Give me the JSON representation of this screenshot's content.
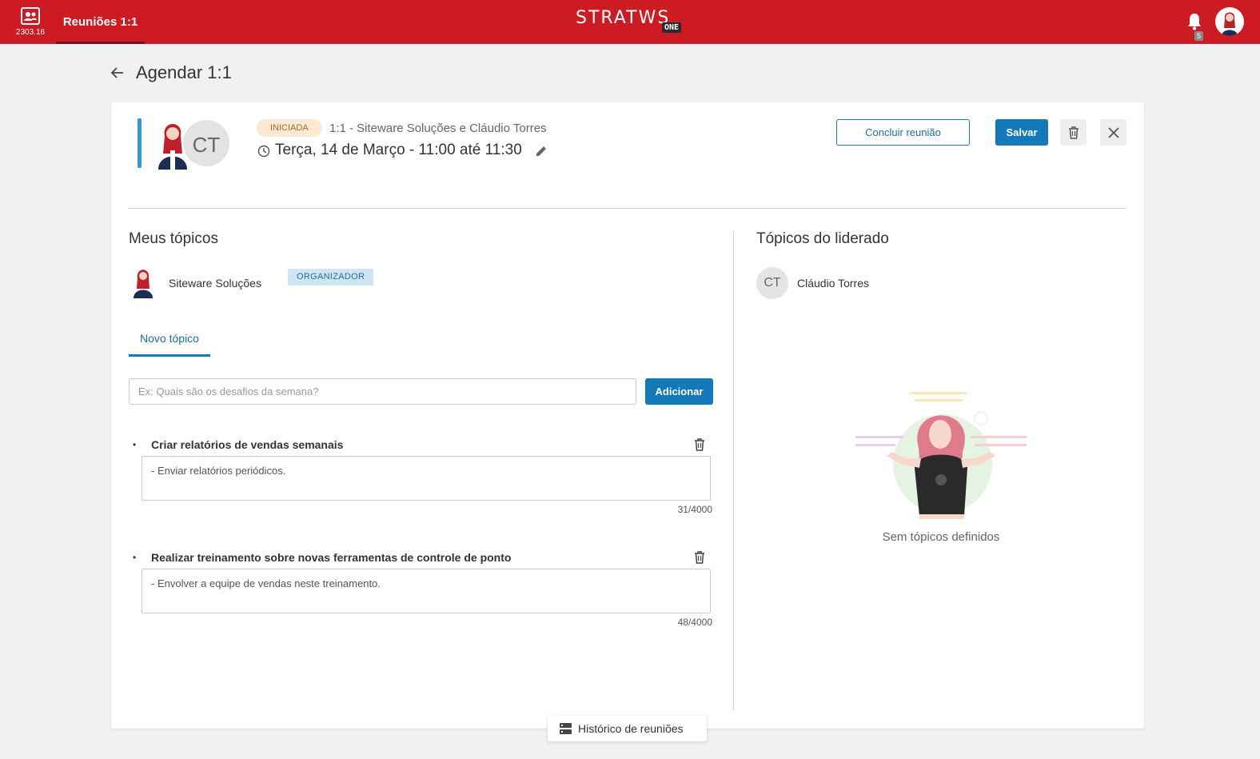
{
  "topbar": {
    "app_code": "2303.16",
    "nav_tab": "Reuniões 1:1",
    "logo_text": "STRATWS",
    "logo_badge": "ONE",
    "notification_count": "5"
  },
  "page": {
    "title": "Agendar 1:1"
  },
  "meeting": {
    "status": "INICIADA",
    "title": "1:1 - Siteware Soluções e Cláudio Torres",
    "datetime": "Terça, 14 de Março - 11:00 até 11:30",
    "leader_initials": "CT",
    "actions": {
      "conclude": "Concluir reunião",
      "save": "Salvar"
    }
  },
  "my_topics": {
    "heading": "Meus tópicos",
    "owner_name": "Siteware Soluções",
    "owner_role": "ORGANIZADOR",
    "tab_label": "Novo tópico",
    "input_placeholder": "Ex: Quais são os desafios da semana?",
    "add_label": "Adicionar",
    "items": [
      {
        "title": "Criar relatórios de vendas semanais",
        "note": "- Enviar relatórios periódicos.",
        "count": "31/4000"
      },
      {
        "title": "Realizar treinamento sobre novas ferramentas de controle de ponto",
        "note": "- Envolver a equipe de vendas neste treinamento.",
        "count": "48/4000"
      }
    ]
  },
  "led_topics": {
    "heading": "Tópicos do liderado",
    "person_initials": "CT",
    "person_name": "Cláudio Torres",
    "empty_text": "Sem tópicos definidos"
  },
  "footer": {
    "history_label": "Histórico de reuniões"
  },
  "colors": {
    "brand_red": "#cc1b22",
    "primary_blue": "#1479b8",
    "accent_blue": "#2f9bd1",
    "status_chip_bg": "#fde8d2"
  }
}
